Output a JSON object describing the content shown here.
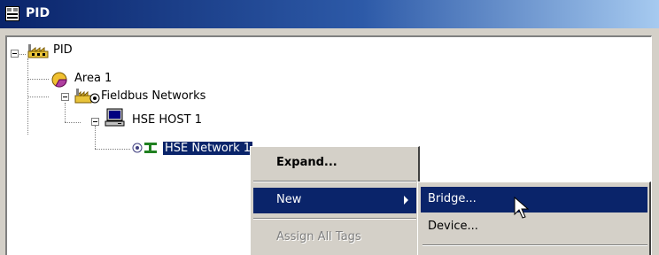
{
  "window": {
    "title": "PID"
  },
  "tree": {
    "root": "PID",
    "items": [
      {
        "label": "Area 1"
      },
      {
        "label": "Fieldbus Networks"
      },
      {
        "label": "HSE HOST 1"
      },
      {
        "label": "HSE Network 1"
      }
    ]
  },
  "context_menu": {
    "items": [
      {
        "label": "Expand..."
      },
      {
        "label": "New"
      },
      {
        "label": "Assign All Tags"
      }
    ]
  },
  "submenu": {
    "items": [
      {
        "label": "Bridge..."
      },
      {
        "label": "Device..."
      }
    ]
  },
  "colors": {
    "selection": "#0a246a",
    "face": "#d4d0c8",
    "title_start": "#0a246a",
    "title_end": "#a6caf0"
  }
}
